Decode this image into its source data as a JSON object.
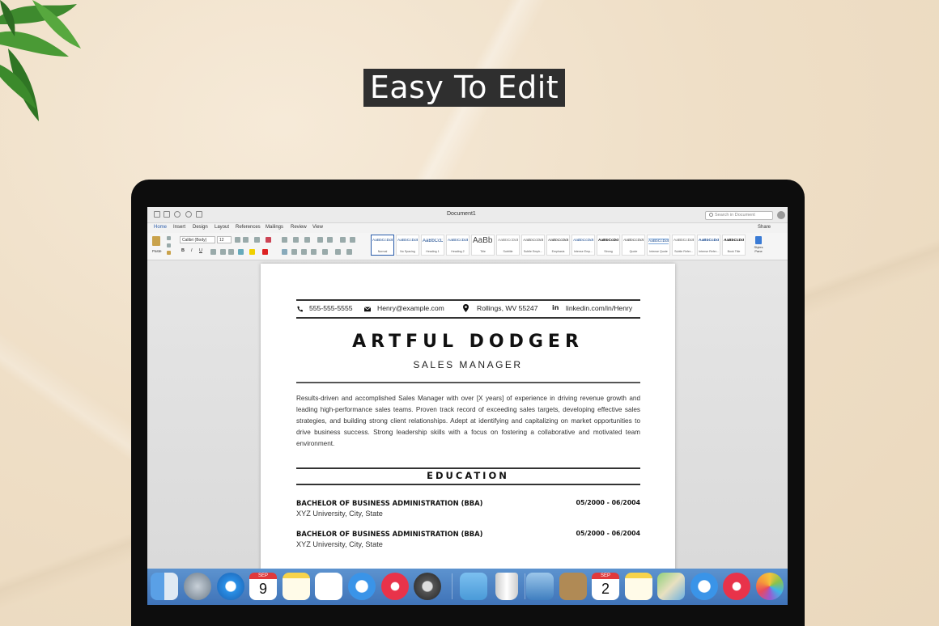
{
  "banner": {
    "text": "Easy To Edit"
  },
  "word": {
    "window_title": "Document1",
    "search_placeholder": "Search in Document",
    "tabs": [
      "Home",
      "Insert",
      "Design",
      "Layout",
      "References",
      "Mailings",
      "Review",
      "View"
    ],
    "share_label": "Share",
    "paste_label": "Paste",
    "font_name": "Calibri (Body)",
    "font_size": "12",
    "styles": [
      {
        "sample": "AaBbCcDdEe",
        "label": "Normal"
      },
      {
        "sample": "AaBbCcDdEe",
        "label": "No Spacing"
      },
      {
        "sample": "AaBbCcDd",
        "label": "Heading 1"
      },
      {
        "sample": "AaBbCcDdEe",
        "label": "Heading 2"
      },
      {
        "sample": "AaBbC",
        "label": "Title"
      },
      {
        "sample": "AaBbCcDdEe",
        "label": "Subtitle"
      },
      {
        "sample": "AaBbCcDdEe",
        "label": "Subtle Emph..."
      },
      {
        "sample": "AaBbCcDdEe",
        "label": "Emphasis"
      },
      {
        "sample": "AaBbCcDdEe",
        "label": "Intense Emp..."
      },
      {
        "sample": "AaBbCcDdEe",
        "label": "Strong"
      },
      {
        "sample": "AaBbCcDdEe",
        "label": "Quote"
      },
      {
        "sample": "AaBbCcDdEe",
        "label": "Intense Quote"
      },
      {
        "sample": "AaBbCcDdEe",
        "label": "Subtle Refer..."
      },
      {
        "sample": "AaBbCcDdEe",
        "label": "Intense Refer..."
      },
      {
        "sample": "AaBbCcDdEe",
        "label": "Book Title"
      }
    ],
    "styles_pane_label": "Styles Pane"
  },
  "resume": {
    "phone": "555-555-5555",
    "email": "Henry@example.com",
    "location": "Rollings, WV 55247",
    "linkedin": "linkedin.com/in/Henry",
    "name": "ARTFUL DODGER",
    "title": "SALES MANAGER",
    "summary": "Results-driven and accomplished Sales Manager with over [X years] of experience in driving revenue growth and leading high-performance sales teams. Proven track record of exceeding sales targets, developing effective sales strategies, and building strong client relationships. Adept at identifying and capitalizing on market opportunities to drive business success. Strong leadership skills with a focus on fostering a collaborative and motivated team environment.",
    "education_heading": "EDUCATION",
    "education": [
      {
        "degree": "BACHELOR OF BUSINESS ADMINISTRATION (BBA)",
        "school": "XYZ University, City, State",
        "dates": "05/2000 - 06/2004"
      },
      {
        "degree": "BACHELOR OF BUSINESS ADMINISTRATION (BBA)",
        "school": "XYZ University, City, State",
        "dates": "05/2000 - 06/2004"
      }
    ]
  },
  "dock": {
    "calendar1_month": "SEP",
    "calendar1_day": "9",
    "calendar2_month": "SEP",
    "calendar2_day": "2",
    "icons": [
      "finder-icon",
      "launchpad-icon",
      "safari-icon",
      "calendar-icon",
      "notes-icon",
      "reminders-icon",
      "messages-icon",
      "itunes-icon",
      "system-preferences-icon",
      "downloads-folder-icon",
      "trash-icon",
      "preview-icon",
      "contacts-icon",
      "calendar-icon",
      "notes-icon",
      "maps-icon",
      "messages-icon",
      "itunes-icon",
      "photos-icon"
    ]
  }
}
